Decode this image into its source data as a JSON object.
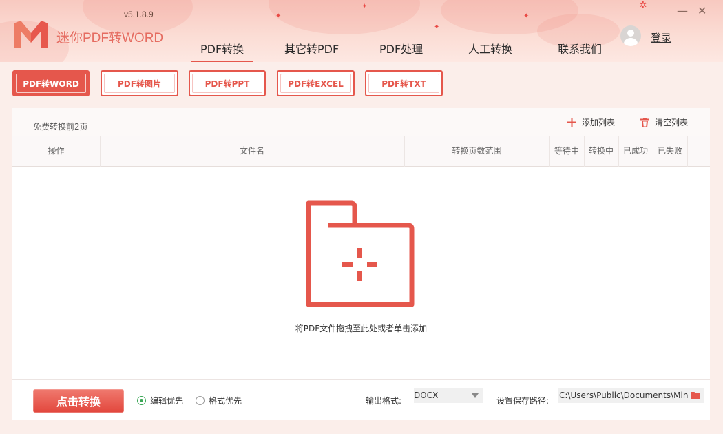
{
  "app": {
    "title": "迷你PDF转WORD",
    "version": "v5.1.8.9",
    "login_label": "登录",
    "minimize_symbol": "—",
    "close_symbol": "✕"
  },
  "main_tabs": [
    {
      "label": "PDF转换",
      "active": true
    },
    {
      "label": "其它转PDF",
      "active": false
    },
    {
      "label": "PDF处理",
      "active": false
    },
    {
      "label": "人工转换",
      "active": false
    },
    {
      "label": "联系我们",
      "active": false
    }
  ],
  "sub_tabs": [
    {
      "label": "PDF转WORD",
      "active": true
    },
    {
      "label": "PDF转图片",
      "active": false
    },
    {
      "label": "PDF转PPT",
      "active": false
    },
    {
      "label": "PDF转EXCEL",
      "active": false
    },
    {
      "label": "PDF转TXT",
      "active": false
    }
  ],
  "toolbar": {
    "free_note": "免费转换前2页",
    "add_list_label": "添加列表",
    "clear_list_label": "清空列表"
  },
  "table": {
    "columns": [
      "操作",
      "文件名",
      "转换页数范围",
      "等待中",
      "转换中",
      "已成功",
      "已失败"
    ]
  },
  "dropzone": {
    "hint": "将PDF文件拖拽至此处或者单击添加"
  },
  "footer": {
    "convert_label": "点击转换",
    "mode_options": [
      {
        "label": "编辑优先",
        "checked": true
      },
      {
        "label": "格式优先",
        "checked": false
      }
    ],
    "output_format_label": "输出格式:",
    "output_format_value": "DOCX",
    "save_path_label": "设置保存路径:",
    "save_path_value": "C:\\Users\\Public\\Documents\\Mini"
  },
  "colors": {
    "accent": "#e5574c",
    "check": "#3aa655"
  },
  "icons": {
    "logo": "m-logo-icon",
    "avatar": "user-avatar-icon",
    "add": "plus-icon",
    "clear": "trash-icon",
    "dropzone": "folder-plus-icon",
    "path": "folder-icon"
  }
}
